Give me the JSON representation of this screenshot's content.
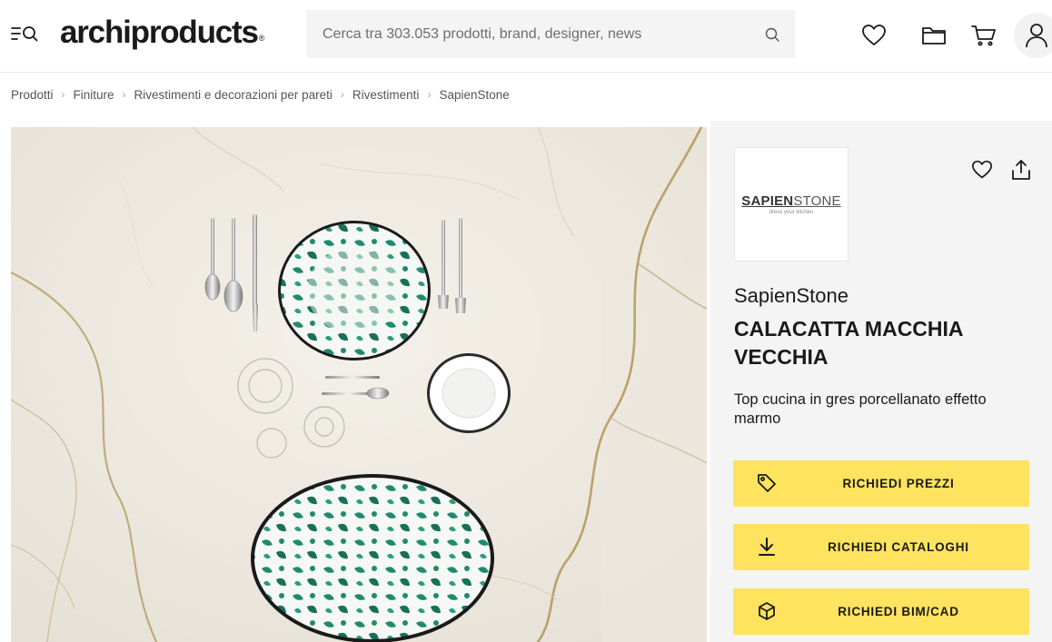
{
  "header": {
    "logo": "archiproducts",
    "logo_mark": "®",
    "search_placeholder": "Cerca tra 303.053 prodotti, brand, designer, news",
    "icons": [
      "menu-search-icon",
      "heart-icon",
      "folder-icon",
      "cart-icon",
      "user-icon"
    ]
  },
  "breadcrumb": [
    "Prodotti",
    "Finiture",
    "Rivestimenti e decorazioni per pareti",
    "Rivestimenti",
    "SapienStone"
  ],
  "product": {
    "brand_logo": {
      "bold": "SAPIEN",
      "light": "STONE",
      "tagline": "dress your kitchen"
    },
    "manufacturer": "SapienStone",
    "title": "CALACATTA MACCHIA VECCHIA",
    "description": "Top cucina in gres porcellanato effetto marmo"
  },
  "actions": [
    {
      "label": "RICHIEDI PREZZI",
      "icon": "price-tag-icon"
    },
    {
      "label": "RICHIEDI CATALOGHI",
      "icon": "download-icon"
    },
    {
      "label": "RICHIEDI BIM/CAD",
      "icon": "cube-icon"
    }
  ],
  "colors": {
    "cta": "#fde35e",
    "panel": "#f4f4f4",
    "text": "#1a1a1a",
    "plate_green": "#1f8a6e"
  }
}
